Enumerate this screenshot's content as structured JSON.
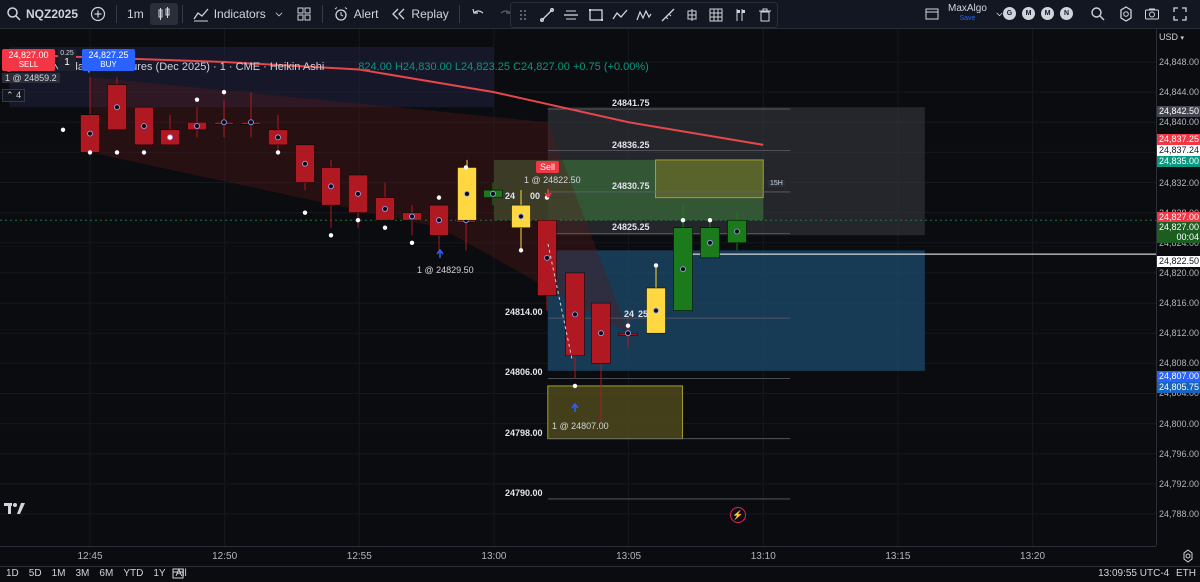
{
  "toolbar": {
    "symbol": "NQZ2025",
    "interval": "1m",
    "indicators_label": "Indicators",
    "alert_label": "Alert",
    "replay_label": "Replay",
    "account_name": "MaxAlgo",
    "account_status": "Save",
    "session_buttons": [
      "G",
      "M",
      "M",
      "N"
    ]
  },
  "legend": {
    "title": "E-mini Nasdaq-100 Futures (Dec 2025) · 1 · CME · Heikin Ashi",
    "ohlc_text": "824.00  H24,830.00  L24,823.25  C24,827.00  +0.75 (+0.00%)"
  },
  "order_panel": {
    "sell_price": "24,827.00",
    "sell_label": "SELL",
    "buy_price": "24,827.25",
    "buy_label": "BUY",
    "qty": "1",
    "spread": "0.25",
    "position_label": "1 @ 24859.2",
    "indicator_count": "4"
  },
  "currency": "USD",
  "y_axis": {
    "ticks": [
      "24,848.00",
      "24,844.00",
      "24,840.00",
      "24,836.00",
      "24,832.00",
      "24,828.00",
      "24,824.00",
      "24,820.00",
      "24,816.00",
      "24,812.00",
      "24,808.00",
      "24,804.00",
      "24,800.00",
      "24,796.00",
      "24,792.00",
      "24,788.00"
    ],
    "flags": [
      {
        "text": "24,842.50",
        "color": "#434651"
      },
      {
        "text": "24,837.25",
        "color": "#f23645"
      },
      {
        "text": "24,837.24",
        "color": "#ffffff"
      },
      {
        "text": "24,835.00",
        "color": "#089981"
      },
      {
        "text": "24,827.00",
        "color": "#f23645"
      },
      {
        "text": "24,827.00",
        "color": "#1b5e20"
      },
      {
        "text": "00:04",
        "color": "#1b5e20"
      },
      {
        "text": "24,822.50",
        "color": "#ffffff"
      },
      {
        "text": "24,807.00",
        "color": "#2962ff"
      },
      {
        "text": "24,805.75",
        "color": "#1565c0"
      }
    ]
  },
  "x_axis": {
    "ticks": [
      "12:45",
      "12:50",
      "12:55",
      "13:00",
      "13:05",
      "13:10",
      "13:15",
      "13:20"
    ]
  },
  "price_levels": [
    "24841.75",
    "24836.25",
    "24830.75",
    "24825.25",
    "24814.00",
    "24806.00",
    "24798.00",
    "24790.00"
  ],
  "trade_labels": {
    "sell_tag": "Sell",
    "sell_fill": "1 @ 24822.50",
    "buy_fill_1": "1 @ 24829.50",
    "buy_fill_2": "1 @ 24807.00",
    "partial_label_1": "24",
    "partial_label_2": "00",
    "partial_label_3": "24",
    "partial_label_4": "25",
    "box_tag": "15H"
  },
  "bottombar": {
    "ranges": [
      "1D",
      "5D",
      "1M",
      "3M",
      "6M",
      "YTD",
      "1Y",
      "All"
    ],
    "clock": "13:09:55 UTC-4",
    "eth": "ETH"
  },
  "chart_data": {
    "type": "candlestick",
    "style": "Heikin Ashi",
    "symbol": "E-mini Nasdaq-100 Futures (Dec 2025)",
    "interval": "1m",
    "ylim": [
      24786,
      24850
    ],
    "x_range_time": [
      "12:42",
      "13:24"
    ],
    "candles": [
      {
        "t": "12:45",
        "o": 24841,
        "h": 24846,
        "l": 24838,
        "c": 24836,
        "color": "red"
      },
      {
        "t": "12:46",
        "o": 24845,
        "h": 24846,
        "l": 24839,
        "c": 24839,
        "color": "red"
      },
      {
        "t": "12:47",
        "o": 24842,
        "h": 24842,
        "l": 24837,
        "c": 24837,
        "color": "red"
      },
      {
        "t": "12:48",
        "o": 24839,
        "h": 24841,
        "l": 24837,
        "c": 24837,
        "color": "red"
      },
      {
        "t": "12:49",
        "o": 24840,
        "h": 24842,
        "l": 24838,
        "c": 24839,
        "color": "red"
      },
      {
        "t": "12:50",
        "o": 24840,
        "h": 24843,
        "l": 24838,
        "c": 24840,
        "color": "red"
      },
      {
        "t": "12:51",
        "o": 24840,
        "h": 24844,
        "l": 24838,
        "c": 24840,
        "color": "red"
      },
      {
        "t": "12:52",
        "o": 24839,
        "h": 24841,
        "l": 24836,
        "c": 24837,
        "color": "red"
      },
      {
        "t": "12:53",
        "o": 24837,
        "h": 24837,
        "l": 24831,
        "c": 24832,
        "color": "red"
      },
      {
        "t": "12:54",
        "o": 24834,
        "h": 24835,
        "l": 24826,
        "c": 24829,
        "color": "red"
      },
      {
        "t": "12:55",
        "o": 24833,
        "h": 24833,
        "l": 24826,
        "c": 24828,
        "color": "red"
      },
      {
        "t": "12:56",
        "o": 24830,
        "h": 24832,
        "l": 24827,
        "c": 24827,
        "color": "red"
      },
      {
        "t": "12:57",
        "o": 24828,
        "h": 24829,
        "l": 24825,
        "c": 24827,
        "color": "red"
      },
      {
        "t": "12:58",
        "o": 24829,
        "h": 24829,
        "l": 24823,
        "c": 24825,
        "color": "red"
      },
      {
        "t": "12:59",
        "o": 24827,
        "h": 24829,
        "l": 24823,
        "c": 24827,
        "color": "red"
      },
      {
        "t": "13:00",
        "o": 24827,
        "h": 24835,
        "l": 24827,
        "c": 24834,
        "color": "yellow"
      },
      {
        "t": "13:00b",
        "o": 24830,
        "h": 24832,
        "l": 24829,
        "c": 24831,
        "color": "green"
      },
      {
        "t": "13:01",
        "o": 24826,
        "h": 24831,
        "l": 24823,
        "c": 24829,
        "color": "yellow"
      },
      {
        "t": "13:02",
        "o": 24827,
        "h": 24827,
        "l": 24815,
        "c": 24817,
        "color": "red"
      },
      {
        "t": "13:03",
        "o": 24820,
        "h": 24820,
        "l": 24806,
        "c": 24809,
        "color": "red"
      },
      {
        "t": "13:04",
        "o": 24816,
        "h": 24816,
        "l": 24800,
        "c": 24808,
        "color": "red"
      },
      {
        "t": "13:05",
        "o": 24812,
        "h": 24814,
        "l": 24810,
        "c": 24812,
        "color": "red"
      },
      {
        "t": "13:06",
        "o": 24812,
        "h": 24821,
        "l": 24812,
        "c": 24818,
        "color": "yellow"
      },
      {
        "t": "13:07",
        "o": 24815,
        "h": 24829,
        "l": 24815,
        "c": 24826,
        "color": "green"
      },
      {
        "t": "13:08",
        "o": 24822,
        "h": 24827,
        "l": 24822,
        "c": 24826,
        "color": "green"
      },
      {
        "t": "13:09",
        "o": 24824,
        "h": 24828,
        "l": 24823,
        "c": 24827,
        "color": "green"
      }
    ],
    "moving_average": {
      "color": "#e5474a",
      "points": [
        [
          24849,
          "12:42"
        ],
        [
          24848,
          "12:50"
        ],
        [
          24847,
          "12:55"
        ],
        [
          24844,
          "13:00"
        ],
        [
          24840,
          "13:05"
        ],
        [
          24837,
          "13:10"
        ]
      ]
    },
    "zones": [
      {
        "name": "upper-purple",
        "from": 24842,
        "to": 24850,
        "start": "12:42",
        "end": "13:00",
        "color": "#2a2f5a"
      },
      {
        "name": "gray-upper",
        "from": 24825,
        "to": 24842,
        "start": "13:02",
        "end": "13:16",
        "color": "#3a3d44"
      },
      {
        "name": "blue-lower",
        "from": 24807,
        "to": 24823,
        "start": "13:02",
        "end": "13:16",
        "color": "#1c4a6e"
      },
      {
        "name": "green-band",
        "from": 24827,
        "to": 24835,
        "start": "13:00",
        "end": "13:10",
        "color": "#3b6b3b"
      },
      {
        "name": "olive-top",
        "from": 24830,
        "to": 24835,
        "start": "13:06",
        "end": "13:10",
        "color": "#6a6a2a"
      },
      {
        "name": "yellow-lower",
        "from": 24798,
        "to": 24805,
        "start": "13:02",
        "end": "13:07",
        "color": "#5a5520"
      }
    ],
    "levels": [
      24841.75,
      24836.25,
      24830.75,
      24825.25,
      24814.0,
      24806.0,
      24798.0,
      24790.0
    ]
  }
}
